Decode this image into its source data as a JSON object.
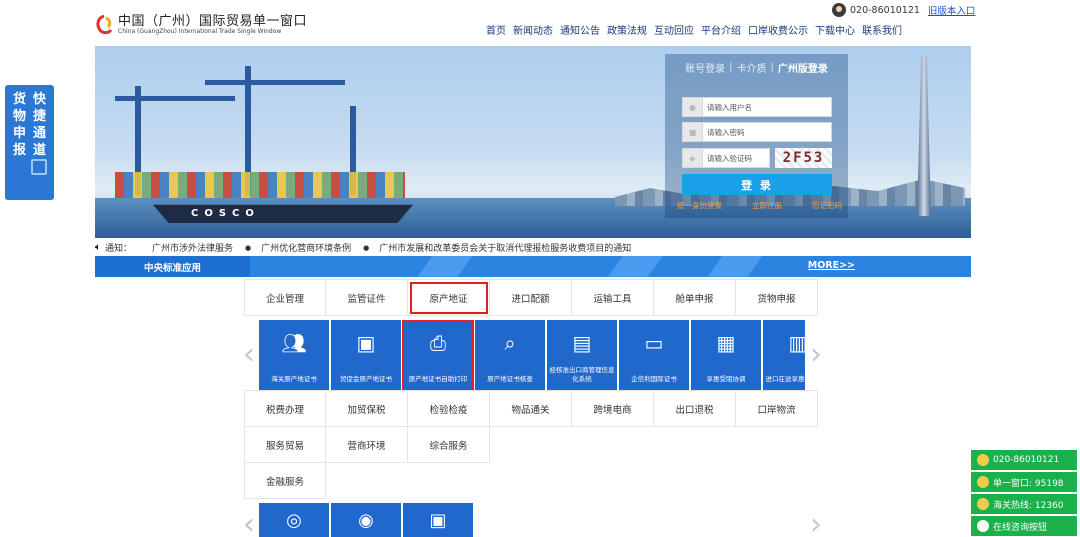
{
  "header": {
    "logo_cn": "中国（广州）国际贸易单一窗口",
    "logo_en": "China (GuangZhou) International Trade Single Window",
    "phone": "020-86010121",
    "old_version_link": "旧版本入口"
  },
  "nav": [
    "首页",
    "新闻动态",
    "通知公告",
    "政策法规",
    "互动回应",
    "平台介绍",
    "口岸收费公示",
    "下载中心",
    "联系我们"
  ],
  "login": {
    "tab_account": "账号登录",
    "tab_card": "卡介质",
    "tab_gz": "广州版登录",
    "username_placeholder": "请输入用户名",
    "password_placeholder": "请输入密码",
    "captcha_placeholder": "请输入验证码",
    "captcha": "2F53",
    "login_button": "登 录",
    "link_unified": "统一身份登录",
    "link_register": "立即注册",
    "link_forgot": "忘记密码"
  },
  "notice": {
    "label": "通知：",
    "items": [
      "广州市涉外法律服务",
      "广州优化营商环境条例",
      "广州市发展和改革委员会关于取消代理报检服务收费项目的通知"
    ]
  },
  "section": {
    "title": "中央标准应用",
    "more": "MORE>>"
  },
  "categories_row1": [
    "企业管理",
    "监管证件",
    "原产地证",
    "进口配额",
    "运输工具",
    "舱单申报",
    "货物申报"
  ],
  "tiles": [
    {
      "label": "海关原产地证书",
      "icon": "users-icon"
    },
    {
      "label": "贸促会原产地证书",
      "icon": "certificate-icon"
    },
    {
      "label": "原产地证书自助打印",
      "icon": "printer-icon"
    },
    {
      "label": "原产地证书核查",
      "icon": "search-doc-icon"
    },
    {
      "label": "经核准出口商管理信息化系统",
      "icon": "exporter-icon"
    },
    {
      "label": "企信利国际证书",
      "icon": "card-icon"
    },
    {
      "label": "享惠受阻协调",
      "icon": "document-icon"
    },
    {
      "label": "进口在途享惠税政申请",
      "icon": "book-icon"
    }
  ],
  "categories_row2": [
    "税费办理",
    "加贸保税",
    "检验检疫",
    "物品通关",
    "跨境电商",
    "出口退税",
    "口岸物流"
  ],
  "categories_row3": [
    "服务贸易",
    "营商环境",
    "综合服务"
  ],
  "categories_row4": [
    "金融服务"
  ],
  "side_float": {
    "chars": [
      "货",
      "快",
      "物",
      "捷",
      "申",
      "通",
      "报",
      "道"
    ]
  },
  "contacts": [
    {
      "label": "020-86010121"
    },
    {
      "label": "单一窗口: 95198"
    },
    {
      "label": "海关热线: 12360"
    },
    {
      "label": "在线咨询按钮"
    }
  ],
  "colors": {
    "primary_blue": "#2168cc",
    "section_blue": "#2a84e0",
    "highlight_red": "#e02121",
    "contact_green": "#1ab04a"
  }
}
